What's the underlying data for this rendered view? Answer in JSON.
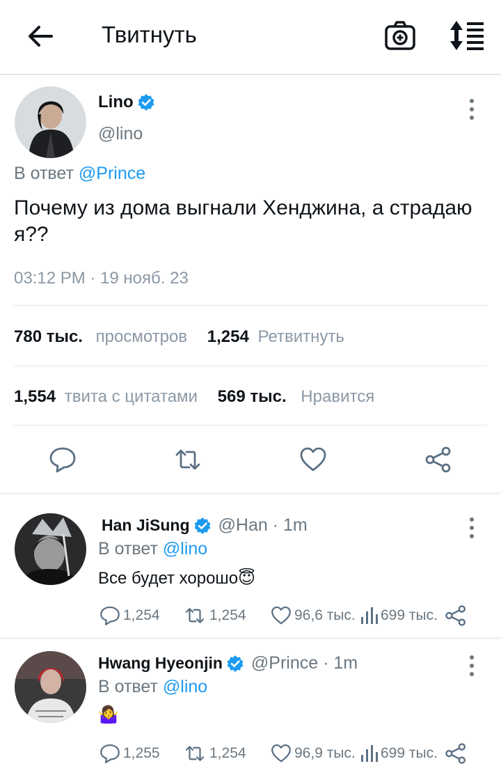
{
  "header": {
    "title": "Твитнуть"
  },
  "tweet": {
    "author_name": "Lino",
    "author_handle": "@lino",
    "reply_prefix": "В ответ",
    "reply_mention": "@Prince",
    "text": "Почему из дома выгнали Хенджина, а страдаю я??",
    "timestamp": "03:12 PM · 19 нояб. 23",
    "views_count": "780 тыс.",
    "views_label": "просмотров",
    "retweets_count": "1,254",
    "retweets_label": "Ретвитнуть",
    "quotes_count": "1,554",
    "quotes_label": "твита с цитатами",
    "likes_count": "569 тыс.",
    "likes_label": "Нравится"
  },
  "replies": [
    {
      "name": "Han JiSung",
      "meta": "@Han · 1m",
      "reply_prefix": "В ответ",
      "reply_mention": "@lino",
      "text": "Все будет хорошо",
      "emoji": "😇",
      "replies": "1,254",
      "retweets": "1,254",
      "likes": "96,6 тыс.",
      "views": "699 тыс."
    },
    {
      "name": "Hwang Hyeonjin",
      "meta": "@Prince · 1m",
      "reply_prefix": "В ответ",
      "reply_mention": "@lino",
      "text": "",
      "emoji": "🤷‍♀️",
      "replies": "1,255",
      "retweets": "1,254",
      "likes": "96,9 тыс.",
      "views": "699 тыс."
    }
  ],
  "colors": {
    "accent": "#1d9bf0",
    "text": "#0f1419",
    "muted": "#8b98a5"
  }
}
